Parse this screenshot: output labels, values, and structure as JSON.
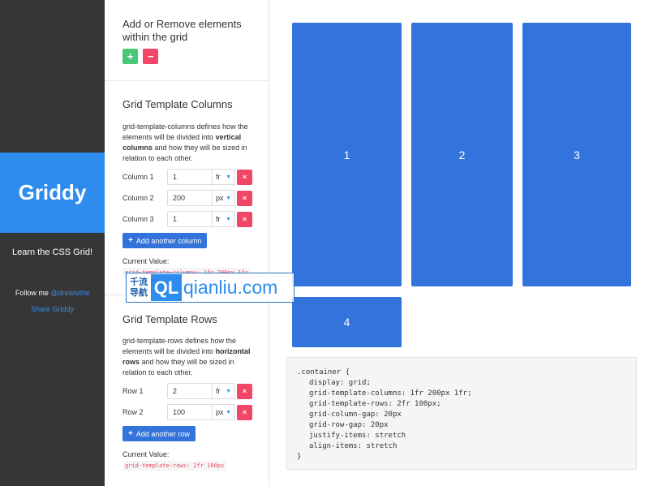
{
  "sidebar": {
    "brand": "Griddy",
    "tagline": "Learn the CSS Grid!",
    "follow_prefix": "Follow me ",
    "follow_handle": "@drewisthe",
    "share": "Share Griddy"
  },
  "add_remove": {
    "title": "Add or Remove elements within the grid",
    "add_label": "+",
    "remove_label": "−"
  },
  "columns": {
    "title": "Grid Template Columns",
    "desc_start": "grid-template-columns defines how the elements will be divided into ",
    "desc_bold": "vertical columns",
    "desc_end": " and how they will be sized in relation to each other.",
    "rows": [
      {
        "label": "Column 1",
        "value": "1",
        "unit": "fr"
      },
      {
        "label": "Column 2",
        "value": "200",
        "unit": "px"
      },
      {
        "label": "Column 3",
        "value": "1",
        "unit": "fr"
      }
    ],
    "add_button": "Add another column",
    "current_label": "Current Value:",
    "current_value": "grid-template-columns: 1fr 200px 1fr"
  },
  "rows": {
    "title": "Grid Template Rows",
    "desc_start": "grid-template-rows defines how the elements will be divided into ",
    "desc_bold": "horizontal rows",
    "desc_end": " and how they will be sized in relation to each other.",
    "rows": [
      {
        "label": "Row 1",
        "value": "2",
        "unit": "fr"
      },
      {
        "label": "Row 2",
        "value": "100",
        "unit": "px"
      }
    ],
    "add_button": "Add another row",
    "current_label": "Current Value:",
    "current_value": "grid-template-rows: 2fr 100px"
  },
  "icons": {
    "delete": "×",
    "chevron": "▼",
    "plus": "+"
  },
  "preview": {
    "cells": [
      "1",
      "2",
      "3",
      "4"
    ]
  },
  "code": {
    "open": ".container {",
    "lines": [
      "display: grid;",
      "grid-template-columns: 1fr 200px 1fr;",
      "grid-template-rows: 2fr 100px;",
      "grid-column-gap: 20px",
      "grid-row-gap: 20px",
      "justify-items: stretch",
      "align-items: stretch"
    ],
    "close": "}"
  },
  "watermark": {
    "cn_line1": "千流",
    "cn_line2": "导航",
    "logo": "QL",
    "site": "qianliu.com"
  },
  "colors": {
    "brand_blue": "#2d8ced",
    "cell_blue": "#3273dc",
    "danger": "#f14668",
    "success": "#48c774"
  }
}
